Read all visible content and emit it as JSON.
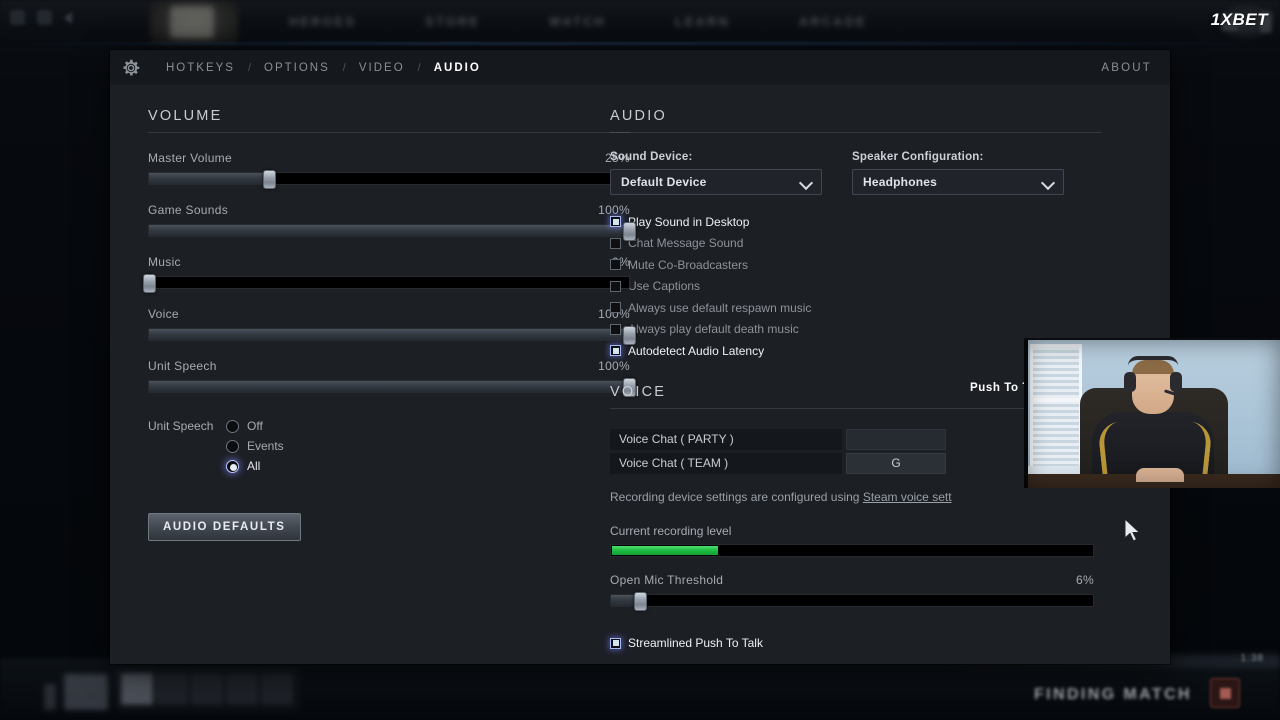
{
  "client": {
    "nav_items": [
      "HEROES",
      "STORE",
      "WATCH",
      "LEARN",
      "ARCADE"
    ],
    "watermark": "1XBET",
    "status_text": "FINDING MATCH",
    "clock": "1:38"
  },
  "settings": {
    "gear_icon": "gear-icon",
    "tabs": [
      {
        "label": "HOTKEYS",
        "active": false
      },
      {
        "label": "OPTIONS",
        "active": false
      },
      {
        "label": "VIDEO",
        "active": false
      },
      {
        "label": "AUDIO",
        "active": true
      }
    ],
    "tab_separator": "/",
    "about_label": "ABOUT"
  },
  "volume": {
    "section_title": "VOLUME",
    "sliders": [
      {
        "label": "Master Volume",
        "value_text": "25%",
        "percent": 25
      },
      {
        "label": "Game Sounds",
        "value_text": "100%",
        "percent": 100
      },
      {
        "label": "Music",
        "value_text": "0%",
        "percent": 0
      },
      {
        "label": "Voice",
        "value_text": "100%",
        "percent": 100
      },
      {
        "label": "Unit Speech",
        "value_text": "100%",
        "percent": 100
      }
    ],
    "unit_speech": {
      "label": "Unit Speech",
      "options": [
        {
          "label": "Off",
          "selected": false
        },
        {
          "label": "Events",
          "selected": false
        },
        {
          "label": "All",
          "selected": true
        }
      ]
    },
    "defaults_button": "AUDIO DEFAULTS"
  },
  "audio": {
    "section_title": "AUDIO",
    "sound_device": {
      "label": "Sound Device:",
      "value": "Default Device",
      "chevron_icon": "chevron-down-icon"
    },
    "speaker_configuration": {
      "label": "Speaker Configuration:",
      "value": "Headphones",
      "chevron_icon": "chevron-down-icon"
    },
    "checkboxes": [
      {
        "label": "Play Sound in Desktop",
        "checked": true
      },
      {
        "label": "Chat Message Sound",
        "checked": false
      },
      {
        "label": "Mute Co-Broadcasters",
        "checked": false
      },
      {
        "label": "Use Captions",
        "checked": false
      },
      {
        "label": "Always use default respawn music",
        "checked": false
      },
      {
        "label": "Always play default death music",
        "checked": false
      },
      {
        "label": "Autodetect Audio Latency",
        "checked": true
      }
    ]
  },
  "voice": {
    "section_title": "VOICE",
    "push_to_talk_header": "Push To Talk",
    "bindings": [
      {
        "name": "Voice Chat ( PARTY )",
        "key": ""
      },
      {
        "name": "Voice Chat ( TEAM )",
        "key": "G"
      }
    ],
    "hint_prefix": "Recording device settings are configured using ",
    "hint_link": "Steam voice sett",
    "recording_level": {
      "label": "Current recording level",
      "percent": 22
    },
    "open_mic_threshold": {
      "label": "Open Mic Threshold",
      "value_text": "6%",
      "percent": 6
    },
    "streamlined": {
      "label": "Streamlined Push To Talk",
      "checked": true
    }
  },
  "colors": {
    "accent_green": "#1bb83f",
    "panel_bg": "#1c1f24",
    "header_bg": "#15181c",
    "text_primary": "#e3e7ec",
    "text_muted": "#8d939a",
    "checkbox_glow": "#6e78e1"
  }
}
